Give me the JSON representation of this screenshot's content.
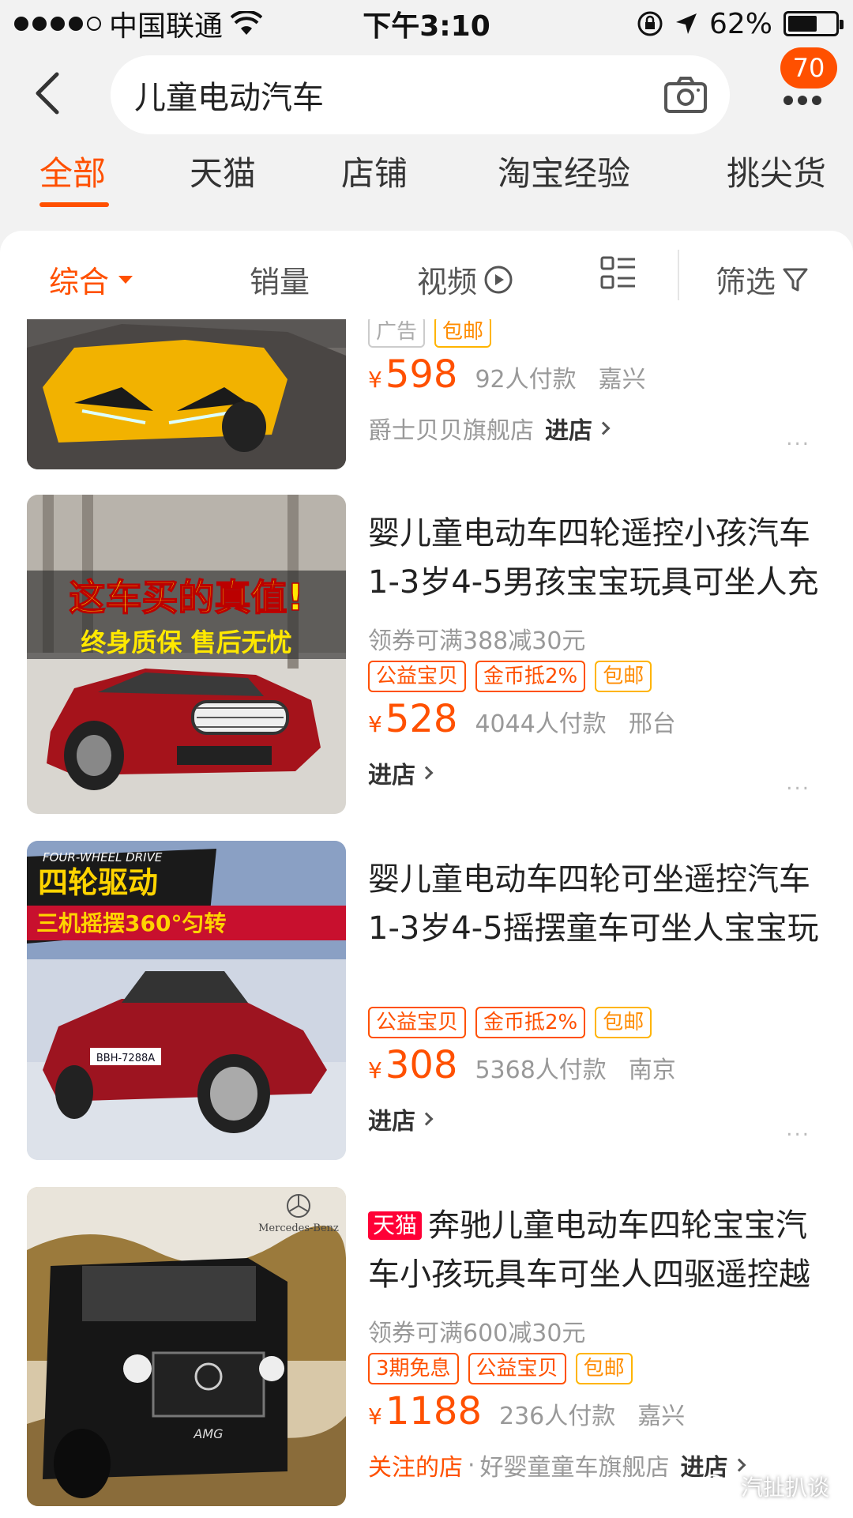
{
  "status_bar": {
    "carrier": "中国联通",
    "time": "下午3:10",
    "battery_percent": "62%",
    "battery_level": 0.62,
    "icons": [
      "signal-dots-icon",
      "wifi-icon",
      "rotation-lock-icon",
      "location-arrow-icon",
      "battery-icon"
    ]
  },
  "header": {
    "search_query": "儿童电动汽车",
    "cart_badge": "70",
    "icons": [
      "back-arrow-icon",
      "camera-icon",
      "more-icon"
    ]
  },
  "category_tabs": [
    "全部",
    "天猫",
    "店铺",
    "淘宝经验",
    "挑尖货"
  ],
  "sort_bar": {
    "items": [
      "综合",
      "销量",
      "视频"
    ],
    "filter_label": "筛选",
    "icons": [
      "dropdown-triangle-icon",
      "play-circle-icon",
      "list-layout-icon",
      "filter-funnel-icon"
    ]
  },
  "products": [
    {
      "tags": [
        {
          "label": "广告",
          "style": "grey"
        },
        {
          "label": "包邮",
          "style": "yellow"
        }
      ],
      "currency": "¥",
      "price": "598",
      "sales": "92人付款",
      "location": "嘉兴",
      "shop": "爵士贝贝旗舰店",
      "enter_label": "进店",
      "more": "..."
    },
    {
      "title": "婴儿童电动车四轮遥控小孩汽车1-3岁4-5男孩宝宝玩具可坐人充",
      "coupon": "领券可满388减30元",
      "tags": [
        {
          "label": "公益宝贝",
          "style": "orange"
        },
        {
          "label": "金币抵2%",
          "style": "orange"
        },
        {
          "label": "包邮",
          "style": "yellow"
        }
      ],
      "currency": "¥",
      "price": "528",
      "sales": "4044人付款",
      "location": "邢台",
      "enter_label": "进店",
      "image_text": [
        "这车买的真值!",
        "终身质保 售后无忧"
      ],
      "more": "..."
    },
    {
      "title": "婴儿童电动车四轮可坐遥控汽车1-3岁4-5摇摆童车可坐人宝宝玩",
      "tags": [
        {
          "label": "公益宝贝",
          "style": "orange"
        },
        {
          "label": "金币抵2%",
          "style": "orange"
        },
        {
          "label": "包邮",
          "style": "yellow"
        }
      ],
      "currency": "¥",
      "price": "308",
      "sales": "5368人付款",
      "location": "南京",
      "enter_label": "进店",
      "image_text": [
        "FOUR-WHEEL DRIVE",
        "四轮驱动",
        "三机摇摆360°匀转",
        "BBH-7288A"
      ],
      "more": "..."
    },
    {
      "badge": "天猫",
      "title": "奔驰儿童电动车四轮宝宝汽车小孩玩具车可坐人四驱遥控越",
      "coupon": "领券可满600减30元",
      "tags": [
        {
          "label": "3期免息",
          "style": "orange"
        },
        {
          "label": "公益宝贝",
          "style": "orange"
        },
        {
          "label": "包邮",
          "style": "yellow"
        }
      ],
      "currency": "¥",
      "price": "1188",
      "sales": "236人付款",
      "location": "嘉兴",
      "shop_prefix": "关注的店",
      "shop_sep": "·",
      "shop": "好婴童童车旗舰店",
      "enter_label": "进店",
      "image_text": [
        "Mercedes-Benz",
        "AMG"
      ]
    }
  ],
  "watermark": "汽扯扒谈",
  "colors": {
    "accent": "#ff5000",
    "tmall_red": "#ff0036",
    "tag_yellow": "#ffb400"
  }
}
